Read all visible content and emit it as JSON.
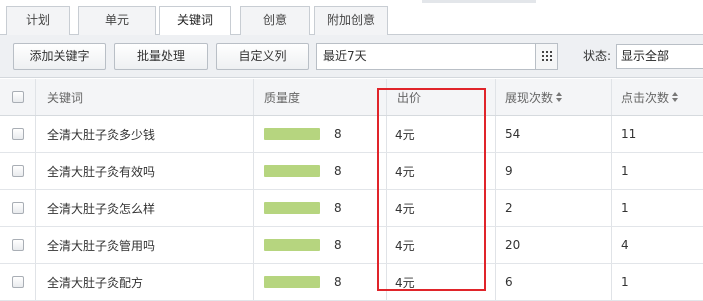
{
  "tabs": [
    {
      "label": "计划"
    },
    {
      "label": "单元"
    },
    {
      "label": "关键词",
      "active": true
    },
    {
      "label": "创意"
    },
    {
      "label": "附加创意"
    }
  ],
  "toolbar": {
    "add_keyword": "添加关键字",
    "batch": "批量处理",
    "custom_columns": "自定义列",
    "date_range": "最近7天",
    "status_label": "状态:",
    "status_value": "显示全部"
  },
  "table": {
    "headers": {
      "keyword": "关键词",
      "quality": "质量度",
      "bid": "出价",
      "impressions": "展现次数",
      "clicks": "点击次数"
    },
    "rows": [
      {
        "keyword": "全清大肚子灸多少钱",
        "quality": "8",
        "quality_fill": 0.8,
        "bid": "4元",
        "impressions": "54",
        "clicks": "11"
      },
      {
        "keyword": "全清大肚子灸有效吗",
        "quality": "8",
        "quality_fill": 0.8,
        "bid": "4元",
        "impressions": "9",
        "clicks": "1"
      },
      {
        "keyword": "全清大肚子灸怎么样",
        "quality": "8",
        "quality_fill": 0.8,
        "bid": "4元",
        "impressions": "2",
        "clicks": "1"
      },
      {
        "keyword": "全清大肚子灸管用吗",
        "quality": "8",
        "quality_fill": 0.8,
        "bid": "4元",
        "impressions": "20",
        "clicks": "4"
      },
      {
        "keyword": "全清大肚子灸配方",
        "quality": "8",
        "quality_fill": 0.8,
        "bid": "4元",
        "impressions": "6",
        "clicks": "1"
      }
    ]
  },
  "colors": {
    "highlight": "#e0242a",
    "quality_bar": "#b6d57f"
  }
}
